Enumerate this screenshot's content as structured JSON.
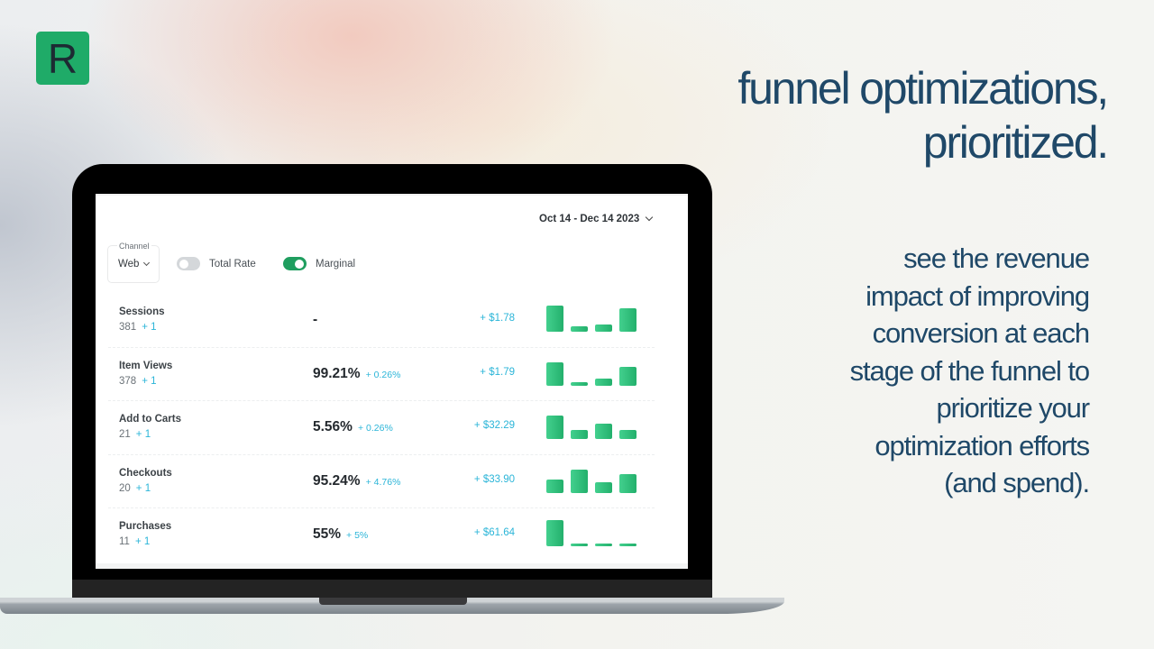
{
  "brand": {
    "logo_letter": "R",
    "accent_color": "#1fab68"
  },
  "marketing": {
    "headline_line1": "funnel optimizations,",
    "headline_line2": "prioritized.",
    "subcopy_lines": [
      "see the revenue",
      "impact of improving",
      "conversion at each",
      "stage of the funnel to",
      "prioritize your",
      "optimization efforts",
      "(and spend)."
    ]
  },
  "dashboard": {
    "date_range": "Oct 14 - Dec 14 2023",
    "channel": {
      "label": "Channel",
      "value": "Web"
    },
    "toggles": [
      {
        "label": "Total Rate",
        "on": false
      },
      {
        "label": "Marginal",
        "on": true
      }
    ],
    "funnel": [
      {
        "stage": "Sessions",
        "count": "381",
        "count_delta": "+ 1",
        "rate": "-",
        "rate_delta": "",
        "revenue": "+ $1.78",
        "bars": [
          0.95,
          0.2,
          0.27,
          0.85
        ]
      },
      {
        "stage": "Item Views",
        "count": "378",
        "count_delta": "+ 1",
        "rate": "99.21%",
        "rate_delta": "+ 0.26%",
        "revenue": "+ $1.79",
        "bars": [
          0.85,
          0.14,
          0.25,
          0.7
        ]
      },
      {
        "stage": "Add to Carts",
        "count": "21",
        "count_delta": "+ 1",
        "rate": "5.56%",
        "rate_delta": "+ 0.26%",
        "revenue": "+ $32.29",
        "bars": [
          0.88,
          0.32,
          0.58,
          0.32
        ]
      },
      {
        "stage": "Checkouts",
        "count": "20",
        "count_delta": "+ 1",
        "rate": "95.24%",
        "rate_delta": "+ 4.76%",
        "revenue": "+ $33.90",
        "bars": [
          0.5,
          0.85,
          0.4,
          0.7
        ]
      },
      {
        "stage": "Purchases",
        "count": "11",
        "count_delta": "+ 1",
        "rate": "55%",
        "rate_delta": "+ 5%",
        "revenue": "+ $61.64",
        "bars": [
          0.95,
          0.1,
          0.1,
          0.1
        ]
      }
    ]
  }
}
